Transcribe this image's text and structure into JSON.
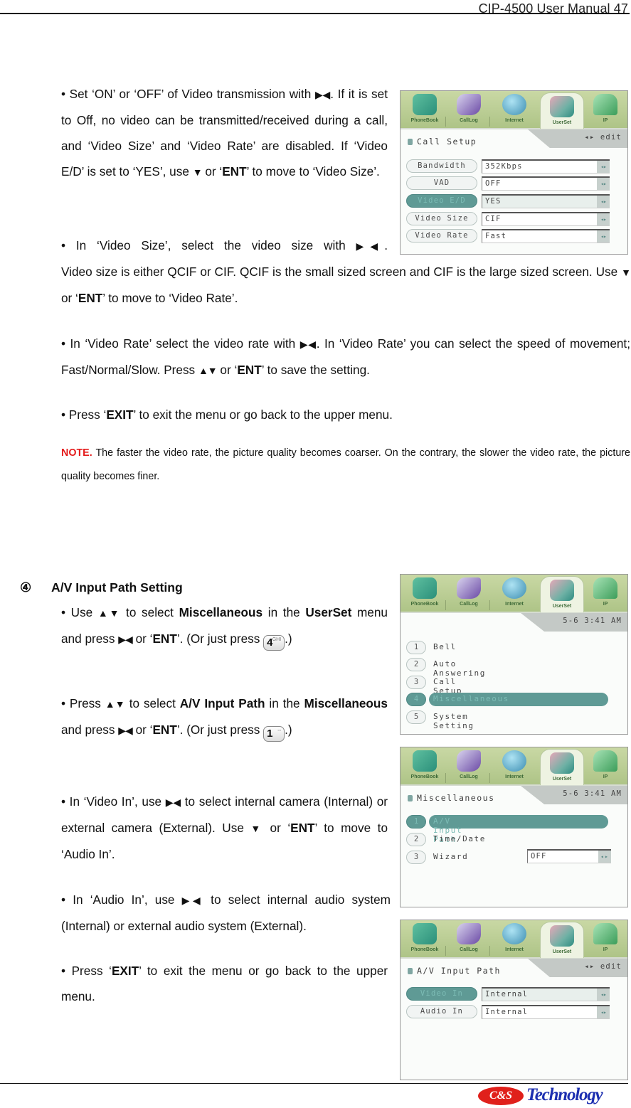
{
  "header": {
    "title": "CIP-4500 User Manual",
    "page_number": "47"
  },
  "section1": {
    "p1": [
      "• Set ‘ON’ or ‘OFF’ of Video transmission with ",
      "▶◀",
      ". If it is set to Off, no video can be transmitted/received during a call, and ‘Video Size’ and ‘Video Rate’ are disabled. If ‘Video E/D’ is set to ‘YES’, use ",
      "▼",
      " or ‘",
      "ENT",
      "’ to move to ‘Video Size’."
    ],
    "p2a": [
      "• In ‘Video Size’, select the video size with ",
      "▶◀",
      "."
    ],
    "p2b": [
      "Video size is either QCIF or CIF. QCIF is the small sized screen and CIF is the large sized screen. Use ",
      "▼",
      " or ‘",
      "ENT",
      "’ to move to ‘Video Rate’."
    ],
    "p3": [
      "• In ‘Video Rate’ select the video rate with ",
      "▶◀",
      ". In ‘Video Rate’ you can select the speed of movement; Fast/Normal/Slow. Press ",
      "▲▼",
      " or ‘",
      "ENT",
      "’ to save the setting."
    ],
    "p4": [
      "• Press ‘",
      "EXIT",
      "’ to exit the menu or go back to the upper menu."
    ],
    "note_label": "NOTE.",
    "note_text": " The faster the video rate, the picture quality becomes coarser. On the contrary, the slower the video rate, the picture quality becomes finer."
  },
  "section2": {
    "number": "④",
    "title": "A/V Input Path Setting",
    "p1": [
      "• Use ",
      "▲▼",
      " to select ",
      "Miscellaneous",
      " in the ",
      "UserSet",
      " menu and press ",
      "▶◀",
      " or ‘",
      "ENT",
      "’. (Or just press ",
      ".)"
    ],
    "p1_key": {
      "digit": "4",
      "sub": "GHI"
    },
    "p2": [
      "• Press ",
      "▲▼",
      " to select ",
      "A/V Input Path",
      " in the ",
      "Miscellaneous",
      " and press ",
      "▶◀",
      " or ‘",
      "ENT",
      "’. (Or just press ",
      ".)"
    ],
    "p2_key": {
      "digit": "1",
      "sub": "◦◦"
    },
    "p3": [
      "• In ‘Video In’, use ",
      "▶◀",
      " to select internal camera (Internal) or external camera (External). Use ",
      "▼",
      " or ‘",
      "ENT",
      "’ to move to ‘Audio In’."
    ],
    "p4": [
      "• In ‘Audio In’, use ",
      "▶◀",
      " to select internal audio system (Internal) or external audio system (External)."
    ],
    "p5": [
      "• Press ‘",
      "EXIT",
      "’ to exit the menu or go back to the upper menu."
    ]
  },
  "tabs": [
    {
      "label": "PhoneBook",
      "icon": "phonebook-icon"
    },
    {
      "label": "CallLog",
      "icon": "calllog-icon"
    },
    {
      "label": "Internet",
      "icon": "internet-icon"
    },
    {
      "label": "UserSet",
      "icon": "userset-icon",
      "selected": true
    },
    {
      "label": "IP",
      "icon": "ip-icon"
    }
  ],
  "screen1": {
    "title": "Call Setup",
    "right": "◂▸ edit",
    "rows": [
      {
        "label": "Bandwidth",
        "value": "352Kbps"
      },
      {
        "label": "VAD",
        "value": "OFF"
      },
      {
        "label": "Video E/D",
        "value": "YES",
        "selected": true
      },
      {
        "label": "Video Size",
        "value": "CIF"
      },
      {
        "label": "Video Rate",
        "value": "Fast"
      }
    ]
  },
  "screen2": {
    "right": "5-6  3:41 AM",
    "items": [
      {
        "num": "1",
        "label": "Bell"
      },
      {
        "num": "2",
        "label": "Auto Answering"
      },
      {
        "num": "3",
        "label": "Call Setup"
      },
      {
        "num": "4",
        "label": "Miscellaneous",
        "selected": true
      },
      {
        "num": "5",
        "label": "System Setting"
      }
    ]
  },
  "screen3": {
    "title": "Miscellaneous",
    "right": "5-6  3:41 AM",
    "items": [
      {
        "num": "1",
        "label": "A/V Input Path",
        "selected": true
      },
      {
        "num": "2",
        "label": "Time/Date"
      },
      {
        "num": "3",
        "label": "Wizard",
        "value": "OFF"
      }
    ]
  },
  "screen4": {
    "title": "A/V Input Path",
    "right": "◂▸ edit",
    "rows": [
      {
        "label": "Video In",
        "value": "Internal",
        "selected": true
      },
      {
        "label": "Audio In",
        "value": "Internal"
      }
    ]
  },
  "arrow_glyph": "◂▸",
  "footer": {
    "logo_mark": "C&S",
    "logo_text": "Technology"
  },
  "colors": {
    "note": "#e41a1a",
    "highlight": "#5f9a95",
    "logo_red": "#e0201b",
    "logo_blue": "#1d2fb0"
  }
}
